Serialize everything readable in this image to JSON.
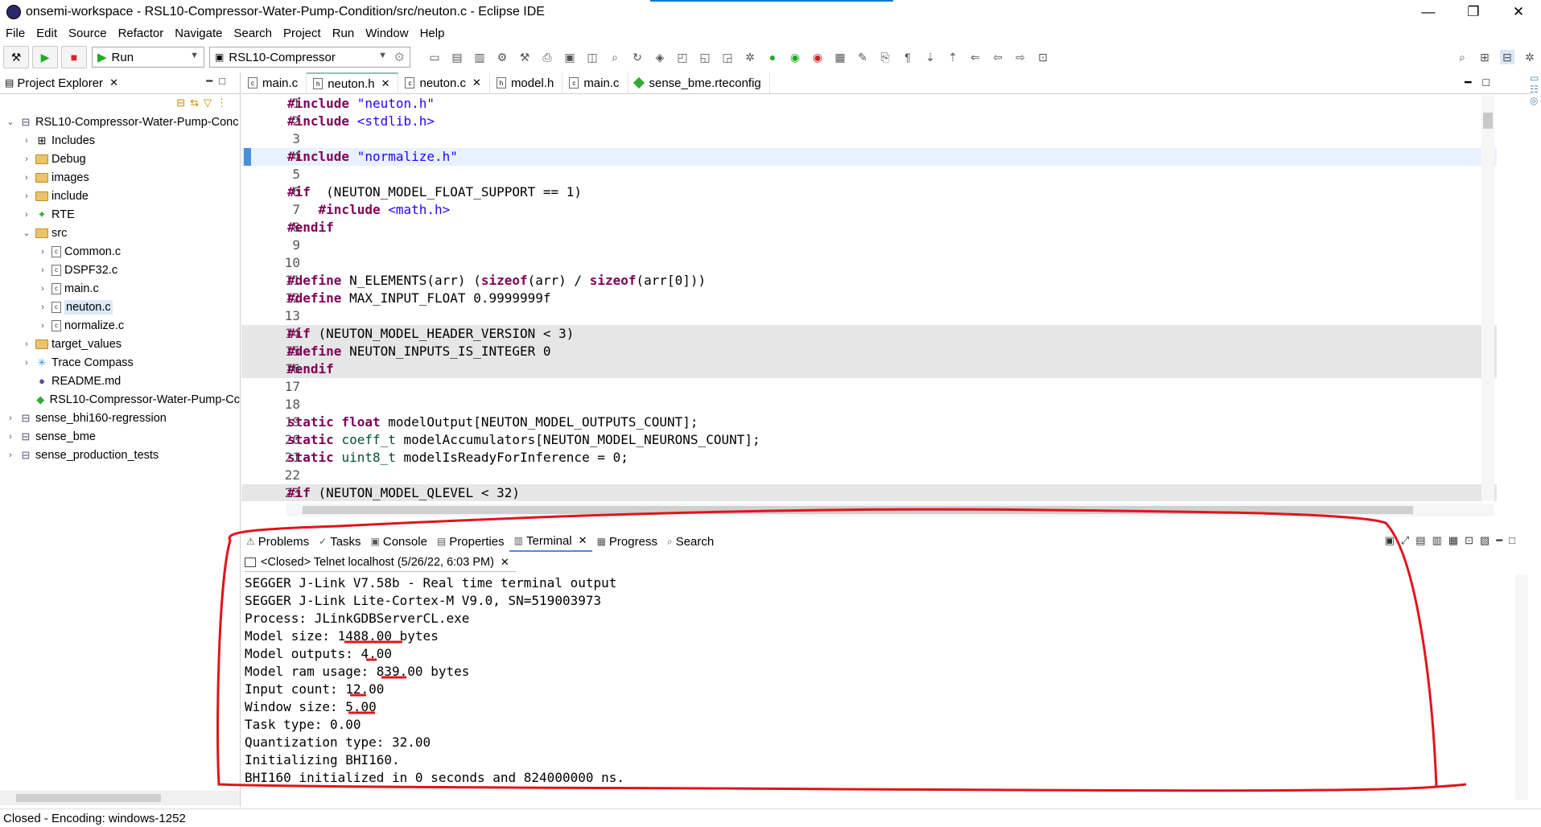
{
  "window": {
    "title": "onsemi-workspace - RSL10-Compressor-Water-Pump-Condition/src/neuton.c - Eclipse IDE",
    "minimize": "—",
    "maximize": "❐",
    "close": "✕"
  },
  "menu": [
    "File",
    "Edit",
    "Source",
    "Refactor",
    "Navigate",
    "Search",
    "Project",
    "Run",
    "Window",
    "Help"
  ],
  "toolbar": {
    "launch_mode": "Run",
    "launch_config": "RSL10-Compressor"
  },
  "explorer": {
    "title": "Project Explorer",
    "items": [
      {
        "label": "RSL10-Compressor-Water-Pump-Conc",
        "depth": 0,
        "twisty": "⌄",
        "icon": "project-icon"
      },
      {
        "label": "Includes",
        "depth": 1,
        "twisty": "›",
        "icon": "includes-icon"
      },
      {
        "label": "Debug",
        "depth": 1,
        "twisty": "›",
        "icon": "folder-icon"
      },
      {
        "label": "images",
        "depth": 1,
        "twisty": "›",
        "icon": "folder-icon"
      },
      {
        "label": "include",
        "depth": 1,
        "twisty": "›",
        "icon": "folder-icon"
      },
      {
        "label": "RTE",
        "depth": 1,
        "twisty": "›",
        "icon": "rte-icon"
      },
      {
        "label": "src",
        "depth": 1,
        "twisty": "⌄",
        "icon": "folder-icon"
      },
      {
        "label": "Common.c",
        "depth": 2,
        "twisty": "›",
        "icon": "c-file-icon"
      },
      {
        "label": "DSPF32.c",
        "depth": 2,
        "twisty": "›",
        "icon": "c-file-icon"
      },
      {
        "label": "main.c",
        "depth": 2,
        "twisty": "›",
        "icon": "c-file-icon"
      },
      {
        "label": "neuton.c",
        "depth": 2,
        "twisty": "›",
        "icon": "c-file-icon",
        "selected": true
      },
      {
        "label": "normalize.c",
        "depth": 2,
        "twisty": "›",
        "icon": "c-file-icon"
      },
      {
        "label": "target_values",
        "depth": 1,
        "twisty": "›",
        "icon": "folder-icon"
      },
      {
        "label": "Trace Compass",
        "depth": 1,
        "twisty": "›",
        "icon": "trace-icon"
      },
      {
        "label": "README.md",
        "depth": 1,
        "twisty": "",
        "icon": "md-icon"
      },
      {
        "label": "RSL10-Compressor-Water-Pump-Cc",
        "depth": 1,
        "twisty": "",
        "icon": "rteconfig-icon"
      },
      {
        "label": "sense_bhi160-regression",
        "depth": 0,
        "twisty": "›",
        "icon": "project-icon"
      },
      {
        "label": "sense_bme",
        "depth": 0,
        "twisty": "›",
        "icon": "project-icon"
      },
      {
        "label": "sense_production_tests",
        "depth": 0,
        "twisty": "›",
        "icon": "project-icon"
      }
    ]
  },
  "editor": {
    "tabs": [
      {
        "label": "main.c",
        "icon": "c-file-icon"
      },
      {
        "label": "neuton.h",
        "icon": "h-file-icon",
        "active": true,
        "closable": true
      },
      {
        "label": "neuton.c",
        "icon": "c-file-icon",
        "closable": true
      },
      {
        "label": "model.h",
        "icon": "h-file-icon"
      },
      {
        "label": "main.c",
        "icon": "c-file-icon"
      },
      {
        "label": "sense_bme.rteconfig",
        "icon": "rteconfig-icon"
      }
    ],
    "lines": [
      {
        "n": "1",
        "t": [
          [
            "kw",
            "#include "
          ],
          [
            "str",
            "\"neuton.h\""
          ]
        ]
      },
      {
        "n": "2",
        "t": [
          [
            "kw",
            "#include "
          ],
          [
            "str",
            "<stdlib.h>"
          ]
        ]
      },
      {
        "n": "3",
        "t": []
      },
      {
        "n": "4",
        "t": [
          [
            "kw",
            "#include "
          ],
          [
            "str",
            "\"normalize.h\""
          ]
        ],
        "cur": true
      },
      {
        "n": "5",
        "t": []
      },
      {
        "n": "6",
        "t": [
          [
            "kw",
            "#if"
          ],
          [
            "",
            "  (NEUTON_MODEL_FLOAT_SUPPORT == 1)"
          ]
        ]
      },
      {
        "n": "7",
        "t": [
          [
            "kw",
            "    #include "
          ],
          [
            "str",
            "<math.h>"
          ]
        ]
      },
      {
        "n": "8",
        "t": [
          [
            "kw",
            "#endif"
          ]
        ]
      },
      {
        "n": "9",
        "t": []
      },
      {
        "n": "10",
        "t": []
      },
      {
        "n": "11",
        "t": [
          [
            "kw",
            "#define"
          ],
          [
            "",
            " N_ELEMENTS(arr) ("
          ],
          [
            "kw",
            "sizeof"
          ],
          [
            "",
            "(arr) / "
          ],
          [
            "kw",
            "sizeof"
          ],
          [
            "",
            "(arr[0]))"
          ]
        ]
      },
      {
        "n": "12",
        "t": [
          [
            "kw",
            "#define"
          ],
          [
            "",
            " MAX_INPUT_FLOAT 0.9999999f"
          ]
        ]
      },
      {
        "n": "13",
        "t": []
      },
      {
        "n": "14",
        "t": [
          [
            "kw",
            "#if"
          ],
          [
            "",
            " (NEUTON_MODEL_HEADER_VERSION < 3)"
          ]
        ],
        "hl": true
      },
      {
        "n": "15",
        "t": [
          [
            "kw",
            "#define"
          ],
          [
            "",
            " NEUTON_INPUTS_IS_INTEGER 0"
          ]
        ],
        "hl": true
      },
      {
        "n": "16",
        "t": [
          [
            "kw",
            "#endif"
          ]
        ],
        "hl": true
      },
      {
        "n": "17",
        "t": []
      },
      {
        "n": "18",
        "t": []
      },
      {
        "n": "19",
        "t": [
          [
            "kw",
            "static float"
          ],
          [
            "",
            " modelOutput[NEUTON_MODEL_OUTPUTS_COUNT];"
          ]
        ]
      },
      {
        "n": "20",
        "t": [
          [
            "kw",
            "static "
          ],
          [
            "ty",
            "coeff_t"
          ],
          [
            "",
            " modelAccumulators[NEUTON_MODEL_NEURONS_COUNT];"
          ]
        ]
      },
      {
        "n": "21",
        "t": [
          [
            "kw",
            "static "
          ],
          [
            "ty",
            "uint8_t"
          ],
          [
            "",
            " modelIsReadyForInference = 0;"
          ]
        ]
      },
      {
        "n": "22",
        "t": []
      },
      {
        "n": "23",
        "t": [
          [
            "kw",
            "#if"
          ],
          [
            "",
            " (NEUTON_MODEL_QLEVEL < 32)"
          ]
        ],
        "hl": true
      }
    ]
  },
  "bottom": {
    "tabs": [
      {
        "label": "Problems",
        "icon": "problems-icon"
      },
      {
        "label": "Tasks",
        "icon": "tasks-icon"
      },
      {
        "label": "Console",
        "icon": "console-icon"
      },
      {
        "label": "Properties",
        "icon": "properties-icon"
      },
      {
        "label": "Terminal",
        "icon": "terminal-icon",
        "active": true,
        "closable": true
      },
      {
        "label": "Progress",
        "icon": "progress-icon"
      },
      {
        "label": "Search",
        "icon": "search-icon"
      }
    ],
    "terminal_tab": "<Closed> Telnet localhost (5/26/22, 6:03 PM)",
    "output": [
      "SEGGER J-Link V7.58b - Real time terminal output",
      "SEGGER J-Link Lite-Cortex-M V9.0, SN=519003973",
      "Process: JLinkGDBServerCL.exe",
      "Model size: 1488.00 bytes",
      "Model outputs: 4.00",
      "Model ram usage: 839.00 bytes",
      "Input count: 12.00",
      "Window size: 5.00",
      "Task type: 0.00",
      "Quantization type: 32.00",
      "Initializing BHI160.",
      "BHI160 initialized in 0 seconds and 824000000 ns."
    ]
  },
  "status": {
    "text": "Closed - Encoding: windows-1252"
  },
  "colors": {
    "annotation": "#e0141e",
    "keyword": "#7f0055",
    "string": "#2a00ff",
    "type": "#005032",
    "selection": "#dbe9f7"
  }
}
